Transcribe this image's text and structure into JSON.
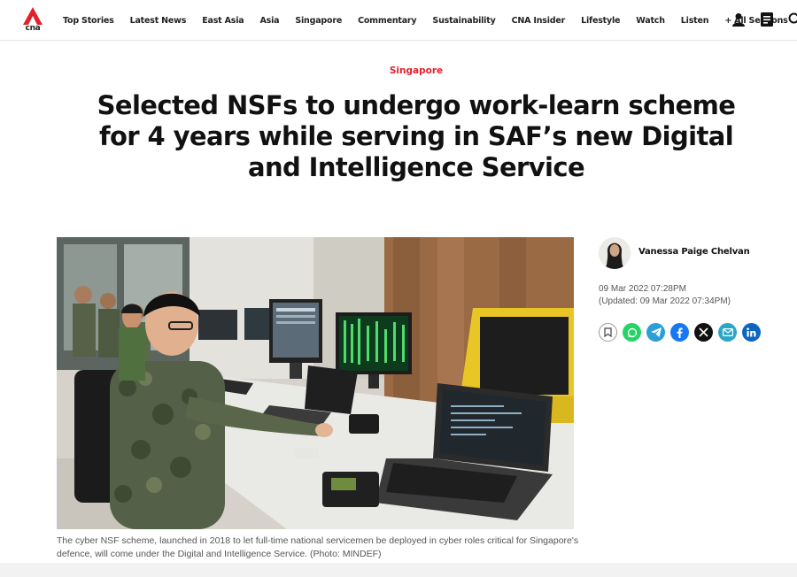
{
  "nav": {
    "logo_text": "cna",
    "items": [
      {
        "label": "Top Stories"
      },
      {
        "label": "Latest News"
      },
      {
        "label": "East Asia"
      },
      {
        "label": "Asia"
      },
      {
        "label": "Singapore"
      },
      {
        "label": "Commentary"
      },
      {
        "label": "Sustainability"
      },
      {
        "label": "CNA Insider"
      },
      {
        "label": "Lifestyle"
      },
      {
        "label": "Watch"
      },
      {
        "label": "Listen"
      },
      {
        "label": "+ All Sections"
      }
    ],
    "icons": [
      "user-icon",
      "menu-icon",
      "search-icon"
    ]
  },
  "article": {
    "section": "Singapore",
    "headline": "Selected NSFs to undergo work-learn scheme for 4 years while serving in SAF’s new Digital and Intelligence Service",
    "caption": "The cyber NSF scheme, launched in 2018 to let full-time national servicemen be deployed in cyber roles critical for Singapore's defence, will come under the Digital and Intelligence Service. (Photo: MINDEF)",
    "author": "Vanessa Paige Chelvan",
    "published": "09 Mar 2022 07:28PM",
    "updated": "(Updated: 09 Mar 2022 07:34PM)"
  },
  "share": [
    {
      "icon": "bookmark-icon",
      "color": "#ffffff"
    },
    {
      "icon": "whatsapp-icon",
      "color": "#25d366"
    },
    {
      "icon": "telegram-icon",
      "color": "#2a9fd8"
    },
    {
      "icon": "facebook-icon",
      "color": "#1877f2"
    },
    {
      "icon": "x-icon",
      "color": "#111111"
    },
    {
      "icon": "email-icon",
      "color": "#2aa7c6"
    },
    {
      "icon": "linkedin-icon",
      "color": "#0a66c2"
    }
  ],
  "colors": {
    "brand_red": "#e3212d",
    "text": "#111111",
    "muted": "#555555"
  }
}
